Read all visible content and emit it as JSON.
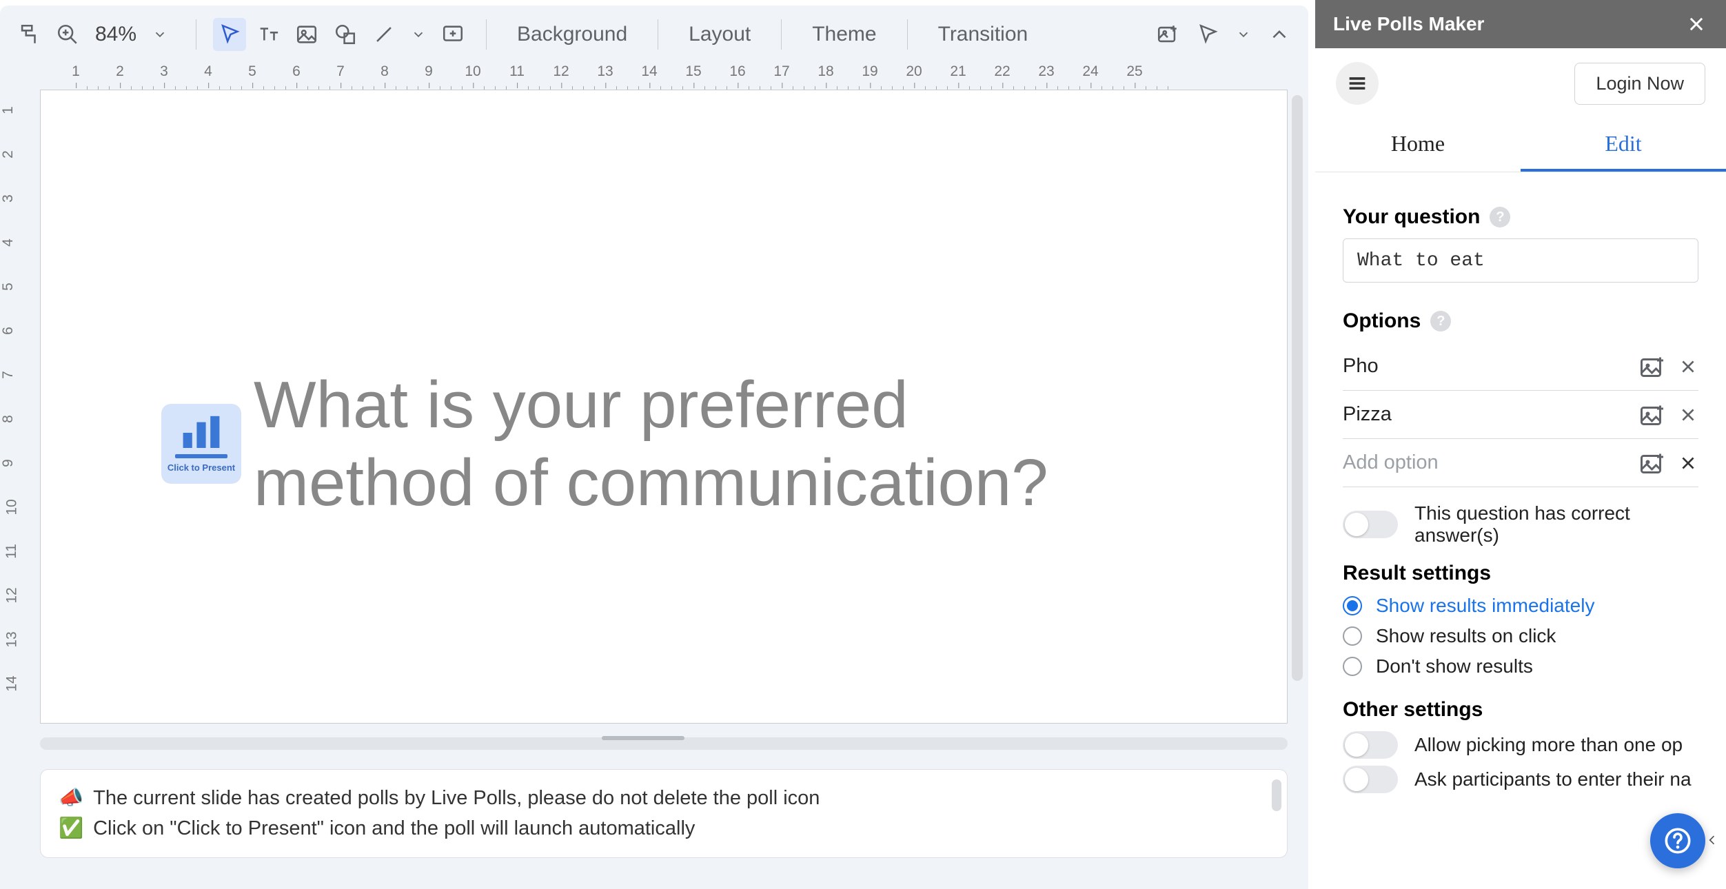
{
  "toolbar": {
    "zoom": "84%",
    "background": "Background",
    "layout": "Layout",
    "theme": "Theme",
    "transition": "Transition"
  },
  "ruler": {
    "h_ticks": [
      1,
      2,
      3,
      4,
      5,
      6,
      7,
      8,
      9,
      10,
      11,
      12,
      13,
      14,
      15,
      16,
      17,
      18,
      19,
      20,
      21,
      22,
      23,
      24,
      25
    ],
    "v_ticks": [
      1,
      2,
      3,
      4,
      5,
      6,
      7,
      8,
      9,
      10,
      11,
      12,
      13,
      14
    ]
  },
  "slide": {
    "click_to_present": "Click to Present",
    "title": "What is your preferred method of communication?"
  },
  "notes": {
    "line1_emoji": "📣",
    "line1": "The current slide has created polls by Live Polls, please do not delete the poll icon",
    "line2_emoji": "✅",
    "line2": "Click on \"Click to Present\" icon and the poll will launch automatically"
  },
  "panel": {
    "title": "Live Polls Maker",
    "login": "Login Now",
    "tabs": {
      "home": "Home",
      "edit": "Edit"
    },
    "question_label": "Your question",
    "question_value": "What to eat",
    "options_label": "Options",
    "options": [
      "Pho",
      "Pizza"
    ],
    "add_option_placeholder": "Add option",
    "correct_answer_label": "This question has correct answer(s)",
    "result_settings_label": "Result settings",
    "result_options": {
      "immediate": "Show results immediately",
      "on_click": "Show results on click",
      "dont_show": "Don't show results"
    },
    "result_selected": "immediate",
    "other_settings_label": "Other settings",
    "other": {
      "multi": "Allow picking more than one op",
      "names": "Ask participants to enter their na"
    }
  }
}
